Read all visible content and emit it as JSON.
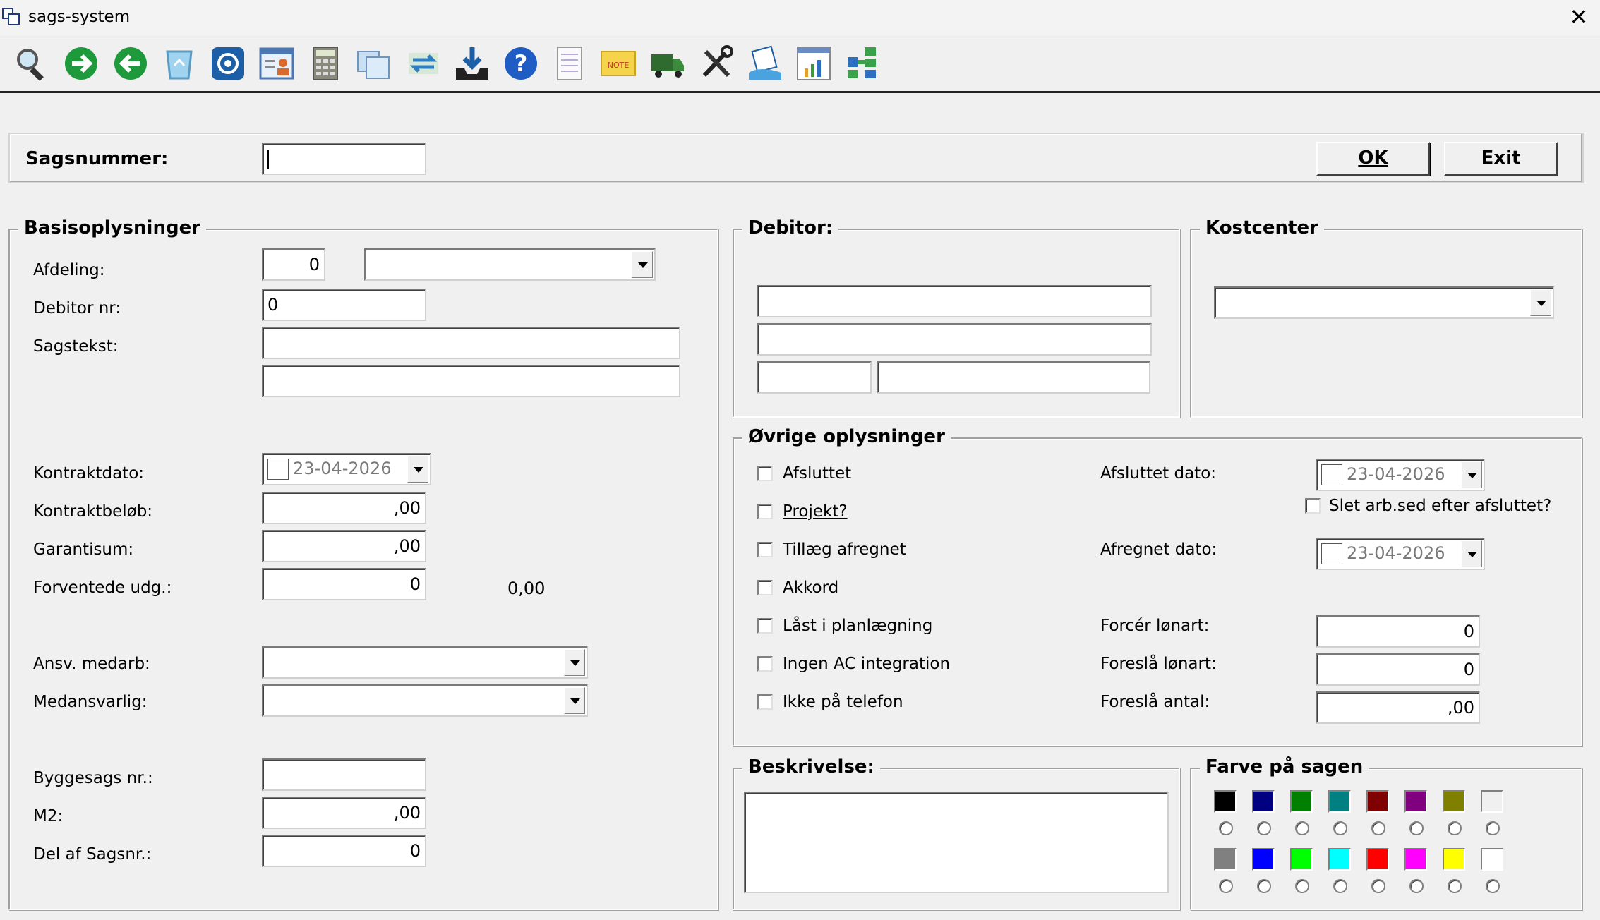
{
  "window": {
    "title": "sags-system",
    "close_glyph": "✕"
  },
  "toolbar": {
    "icons": [
      "search-icon",
      "forward-arrow-icon",
      "back-arrow-icon",
      "recycle-bin-icon",
      "target-icon",
      "user-card-icon",
      "calculator-icon",
      "folders-icon",
      "transfer-icon",
      "download-tray-icon",
      "help-icon",
      "notepad-icon",
      "sticky-note-icon",
      "truck-icon",
      "tools-icon",
      "hand-document-icon",
      "bar-chart-icon",
      "grid-blocks-icon"
    ],
    "note_text": "NOTE"
  },
  "header": {
    "sagsnummer_label": "Sagsnummer:",
    "sagsnummer_value": "",
    "ok_label": "OK",
    "exit_label": "Exit"
  },
  "basis": {
    "legend": "Basisoplysninger",
    "afdeling_label": "Afdeling:",
    "afdeling_value": "0",
    "afdeling_combo_value": "",
    "debitor_nr_label": "Debitor nr:",
    "debitor_nr_value": "0",
    "sagstekst_label": "Sagstekst:",
    "sagstekst_value1": "",
    "sagstekst_value2": "",
    "kontraktdato_label": "Kontraktdato:",
    "kontraktdato_value": "23-04-2026",
    "kontraktbelob_label": "Kontraktbeløb:",
    "kontraktbelob_value": ",00",
    "garantisum_label": "Garantisum:",
    "garantisum_value": ",00",
    "forventede_label": "Forventede udg.:",
    "forventede_value": "0",
    "forventede_total": "0,00",
    "ansv_label": "Ansv. medarb:",
    "ansv_value": "",
    "medansvarlig_label": "Medansvarlig:",
    "medansvarlig_value": "",
    "byggesag_label": "Byggesags nr.:",
    "byggesag_value": "",
    "m2_label": "M2:",
    "m2_value": ",00",
    "del_af_label": "Del af Sagsnr.:",
    "del_af_value": "0"
  },
  "debitor": {
    "legend": "Debitor:",
    "line1": "",
    "line2": "",
    "zip": "",
    "city": ""
  },
  "kostcenter": {
    "legend": "Kostcenter",
    "value": ""
  },
  "ovrige": {
    "legend": "Øvrige oplysninger",
    "afsluttet_label": "Afsluttet",
    "projekt_label": "Projekt?",
    "tillaeg_label": "Tillæg afregnet",
    "akkord_label": "Akkord",
    "laast_label": "Låst i planlægning",
    "ingen_ac_label": "Ingen AC integration",
    "ikke_tlf_label": "Ikke på telefon",
    "afsluttet_dato_label": "Afsluttet dato:",
    "afsluttet_dato_value": "23-04-2026",
    "slet_label": "Slet arb.sed efter afsluttet?",
    "afregnet_dato_label": "Afregnet dato:",
    "afregnet_dato_value": "23-04-2026",
    "forcer_label": "Forcér lønart:",
    "forcer_value": "0",
    "foresla_lonart_label": "Foreslå lønart:",
    "foresla_lonart_value": "0",
    "foresla_antal_label": "Foreslå antal:",
    "foresla_antal_value": ",00"
  },
  "beskrivelse": {
    "legend": "Beskrivelse:",
    "value": ""
  },
  "farve": {
    "legend": "Farve på sagen",
    "row1": [
      "#000000",
      "#000080",
      "#008000",
      "#008080",
      "#800000",
      "#800080",
      "#808000",
      "#f0f0f0"
    ],
    "row2": [
      "#808080",
      "#0000ff",
      "#00ff00",
      "#00ffff",
      "#ff0000",
      "#ff00ff",
      "#ffff00",
      "#ffffff"
    ]
  }
}
